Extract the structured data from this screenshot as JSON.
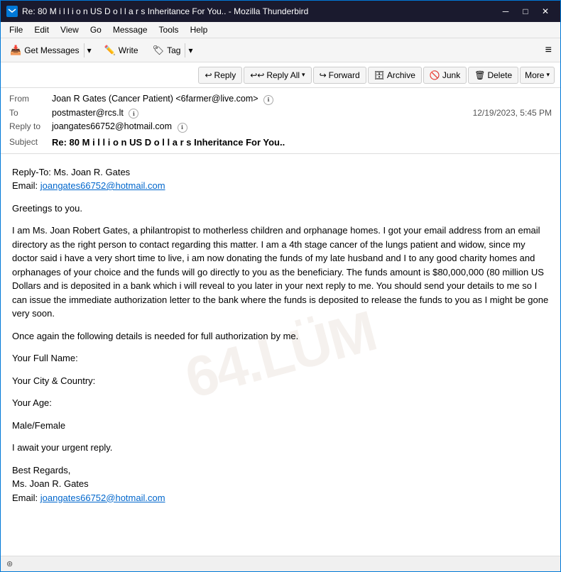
{
  "window": {
    "title": "Re: 80 M i l l i o n US D o l l a r s Inheritance For You.. - Mozilla Thunderbird",
    "icon_text": "TB"
  },
  "menu": {
    "items": [
      "File",
      "Edit",
      "View",
      "Go",
      "Message",
      "Tools",
      "Help"
    ]
  },
  "toolbar": {
    "get_messages_label": "Get Messages",
    "write_label": "Write",
    "tag_label": "Tag",
    "hamburger": "≡"
  },
  "action_toolbar": {
    "reply_label": "Reply",
    "reply_all_label": "Reply All",
    "forward_label": "Forward",
    "archive_label": "Archive",
    "junk_label": "Junk",
    "delete_label": "Delete",
    "more_label": "More"
  },
  "email_header": {
    "from_label": "From",
    "from_value": "Joan R Gates (Cancer Patient) <6farmer@live.com>",
    "to_label": "To",
    "to_value": "postmaster@rcs.lt",
    "reply_to_label": "Reply to",
    "reply_to_value": "joangates66752@hotmail.com",
    "subject_label": "Subject",
    "subject_value": "Re: 80 M i l l i o n US D o l l a r s Inheritance For You..",
    "date": "12/19/2023, 5:45 PM"
  },
  "email_body": {
    "reply_to_line": "Reply-To: Ms. Joan R. Gates",
    "email_line": "Email: joangates66752@hotmail.com",
    "greeting": "Greetings to you.",
    "paragraph1": "I am Ms. Joan Robert Gates, a philantropist to motherless children and orphanage homes. I got your email address from an email directory as the right person to contact regarding this matter. I am a 4th stage cancer of the lungs patient and widow, since my doctor said i have a very short time to live, i am now donating the funds of my late husband and I to any good charity homes and orphanages of your choice and the funds will go directly to you as the beneficiary. The funds amount is $80,000,000 (80 million US Dollars and is deposited in a bank which i will reveal to you later in your next reply to me. You should send your details to me so I can issue the immediate authorization letter to the bank where the funds is deposited to release the funds to you as I might be gone very soon.",
    "paragraph2": "Once again the following details is needed for full authorization by me.",
    "full_name": "Your Full Name:",
    "city_country": "Your City & Country:",
    "age": "Your Age:",
    "gender": "Male/Female",
    "urgent": "I await your urgent reply.",
    "regards": "Best Regards,",
    "signature_name": "Ms. Joan R. Gates",
    "signature_email_label": "Email: ",
    "signature_email": "joangates66752@hotmail.com",
    "watermark": "64.LÜM"
  },
  "status_bar": {
    "text": "⊛"
  }
}
